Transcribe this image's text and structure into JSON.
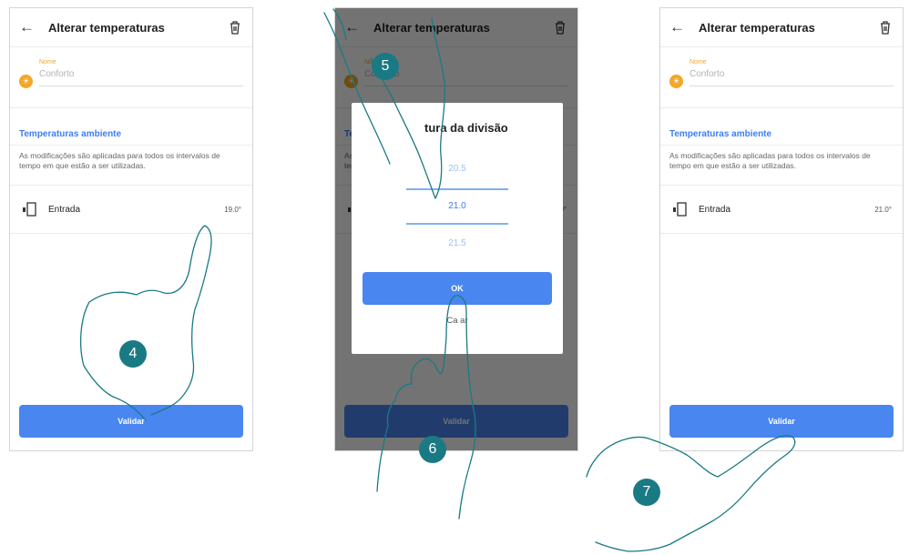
{
  "screen_title": "Alterar temperaturas",
  "name_label": "Nome",
  "name_value": "Conforto",
  "section_title": "Temperaturas ambiente",
  "section_description": "As modificações são aplicadas para todos os intervalos de tempo em que estão a ser utilizadas.",
  "room_name": "Entrada",
  "room_temp_before": "19.0°",
  "room_temp_after": "21.0°",
  "validate_label": "Validar",
  "dialog": {
    "title": "tura da divisão",
    "values": [
      "20.5",
      "21.0",
      "21.5"
    ],
    "ok_label": "OK",
    "cancel_label": "Ca      ar"
  },
  "steps": [
    "4",
    "5",
    "6",
    "7"
  ],
  "colors": {
    "accent": "#4a86f0",
    "name_icon": "#f5a623",
    "badge": "#1a7a84"
  },
  "icons": {
    "back": "arrow-left-icon",
    "delete": "trash-icon",
    "name": "sun-icon",
    "room": "door-thermostat-icon"
  }
}
